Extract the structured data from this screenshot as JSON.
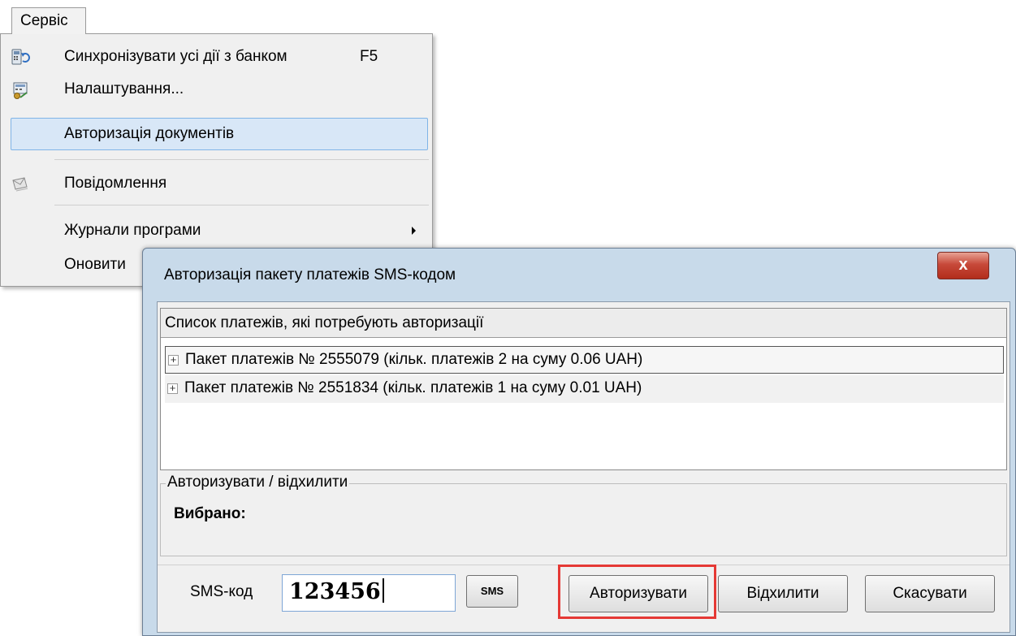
{
  "menu": {
    "title": "Сервіс",
    "items": [
      {
        "label": "Синхронізувати усі дії з банком",
        "shortcut": "F5",
        "icon": "sync-bank-icon"
      },
      {
        "label": "Налаштування...",
        "icon": "settings-icon"
      },
      {
        "label": "Авторизація документів",
        "highlighted": true
      },
      {
        "label": "Повідомлення",
        "icon": "messages-icon"
      },
      {
        "label": "Журнали програми",
        "submenu": true
      },
      {
        "label": "Оновити"
      }
    ]
  },
  "dialog": {
    "title": "Авторизація пакету платежів SMS-кодом",
    "close_label": "x",
    "list": {
      "header": "Список платежів, які потребують авторизації",
      "items": [
        {
          "expander": "+",
          "text": "Пакет платежів № 2555079 (кільк. платежів 2 на суму 0.06 UAH)"
        },
        {
          "expander": "+",
          "text": "Пакет платежів № 2551834 (кільк. платежів 1 на суму 0.01 UAH)"
        }
      ]
    },
    "group": {
      "title": "Авторизувати / відхилити",
      "selected_label": "Вибрано:"
    },
    "sms": {
      "label": "SMS-код",
      "value": "123456",
      "resend_label": "SMS"
    },
    "buttons": {
      "authorize": "Авторизувати",
      "reject": "Відхилити",
      "cancel": "Скасувати"
    },
    "highlight_color": "#e53935"
  }
}
